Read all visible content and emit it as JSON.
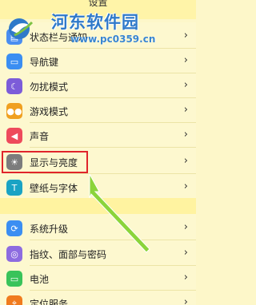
{
  "header": {
    "title": "设置"
  },
  "watermark": {
    "site_name": "河东软件园",
    "url": "www.pc0359.cn"
  },
  "group_one": [
    {
      "label": "状态栏与通知",
      "icon": "notification-icon",
      "color": "#4a8df0"
    },
    {
      "label": "导航键",
      "icon": "navigation-key-icon",
      "color": "#3b8ef2"
    },
    {
      "label": "勿扰模式",
      "icon": "moon-icon",
      "color": "#7c5cd9"
    },
    {
      "label": "游戏模式",
      "icon": "game-controller-icon",
      "color": "#f0a020"
    },
    {
      "label": "声音",
      "icon": "speaker-icon",
      "color": "#ee4a5c"
    },
    {
      "label": "显示与亮度",
      "icon": "brightness-icon",
      "color": "#7c7c7c"
    },
    {
      "label": "壁纸与字体",
      "icon": "text-icon",
      "color": "#1aa3c4"
    }
  ],
  "group_two": [
    {
      "label": "系统升级",
      "icon": "system-update-icon",
      "color": "#3b8ef2"
    },
    {
      "label": "指纹、面部与密码",
      "icon": "fingerprint-icon",
      "color": "#8d6be0"
    },
    {
      "label": "电池",
      "icon": "battery-icon",
      "color": "#39c35a"
    },
    {
      "label": "定位服务",
      "icon": "location-icon",
      "color": "#f07b1e"
    }
  ],
  "colors": {
    "highlight": "#e0242b",
    "arrow": "#8bd43a"
  }
}
